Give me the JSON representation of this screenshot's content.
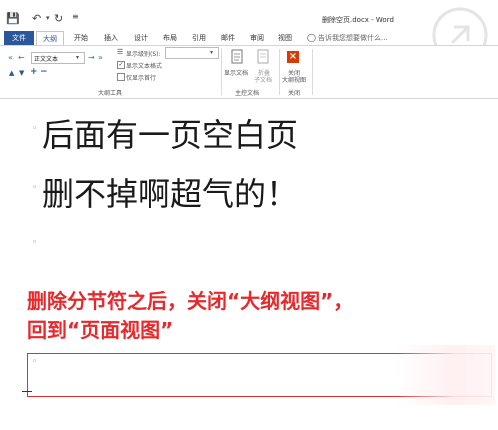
{
  "titlebar": {
    "doc_title": "删除空页.docx - Word"
  },
  "tabs": [
    "文件",
    "大纲",
    "开始",
    "插入",
    "设计",
    "布局",
    "引用",
    "邮件",
    "审阅",
    "视图"
  ],
  "search_hint": "告诉我您想要做什么...",
  "ribbon": {
    "level_dropdown_value": "正文文本",
    "show_level_label": "显示级别(S):",
    "show_text_format_label": "显示文本格式",
    "show_first_line_label": "仅显示首行",
    "show_text_format_checked": true,
    "show_first_line_checked": false,
    "group_outline_tools": "大纲工具",
    "show_document_label": "显示文档",
    "collapse_subdocs_label_1": "折叠",
    "collapse_subdocs_label_2": "子文档",
    "group_master_doc": "主控文档",
    "close_outline_label_1": "关闭",
    "close_outline_label_2": "大纲视图",
    "group_close": "关闭"
  },
  "document": {
    "line1": "后面有一页空白页",
    "line2": "删不掉啊超气的！",
    "annotation_line1": "删除分节符之后，关闭“大纲视图”，",
    "annotation_line2": "回到“页面视图”"
  },
  "colors": {
    "accent": "#2b579a",
    "annotation": "#e8282b",
    "close_icon": "#d83b01"
  }
}
